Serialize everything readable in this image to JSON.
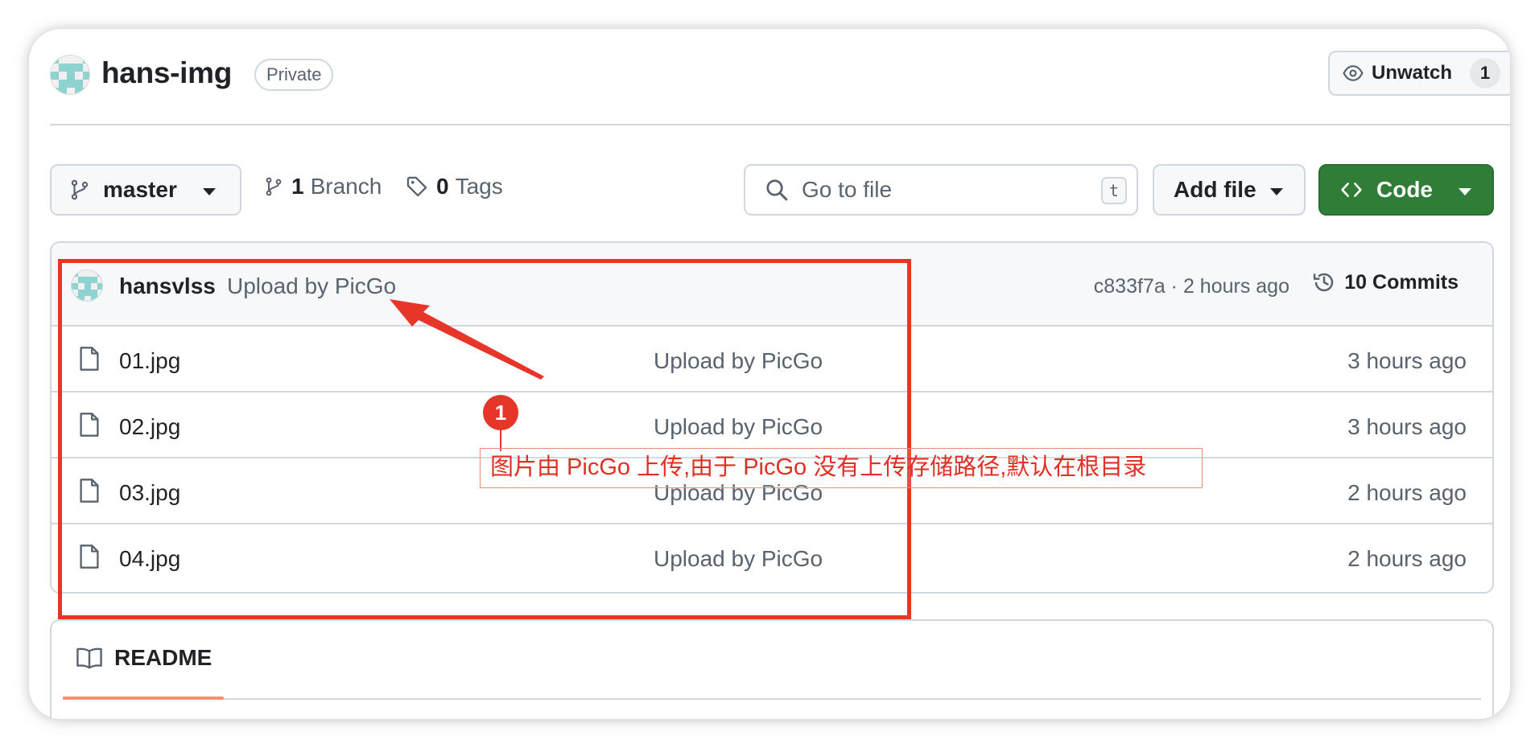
{
  "repo": {
    "name": "hans-img",
    "visibility": "Private",
    "avatar_icon": "identicon",
    "unwatch_label": "Unwatch",
    "unwatch_count": "1"
  },
  "toolbar": {
    "branch": "master",
    "branch_count": "1",
    "branch_label": "Branch",
    "tag_count": "0",
    "tag_label": "Tags",
    "search_placeholder": "Go to file",
    "search_shortcut": "t",
    "add_file_label": "Add file",
    "code_label": "Code"
  },
  "latest_commit": {
    "author": "hansvlss",
    "message": "Upload by PicGo",
    "meta": "c833f7a · 2 hours ago",
    "commits_label": "10 Commits"
  },
  "files": [
    {
      "name": "01.jpg",
      "message": "Upload by PicGo",
      "time": "3 hours ago"
    },
    {
      "name": "02.jpg",
      "message": "Upload by PicGo",
      "time": "3 hours ago"
    },
    {
      "name": "03.jpg",
      "message": "Upload by PicGo",
      "time": "2 hours ago"
    },
    {
      "name": "04.jpg",
      "message": "Upload by PicGo",
      "time": "2 hours ago"
    }
  ],
  "readme": {
    "tab_label": "README"
  },
  "annotation": {
    "badge": "1",
    "text": "图片由 PicGo 上传,由于 PicGo 没有上传存储路径,默认在根目录",
    "color": "#e8352a"
  },
  "colors": {
    "code_button": "#2f7d37",
    "border": "#d0d7de",
    "muted_text": "#59636e",
    "readme_accent": "#fd8c73"
  }
}
